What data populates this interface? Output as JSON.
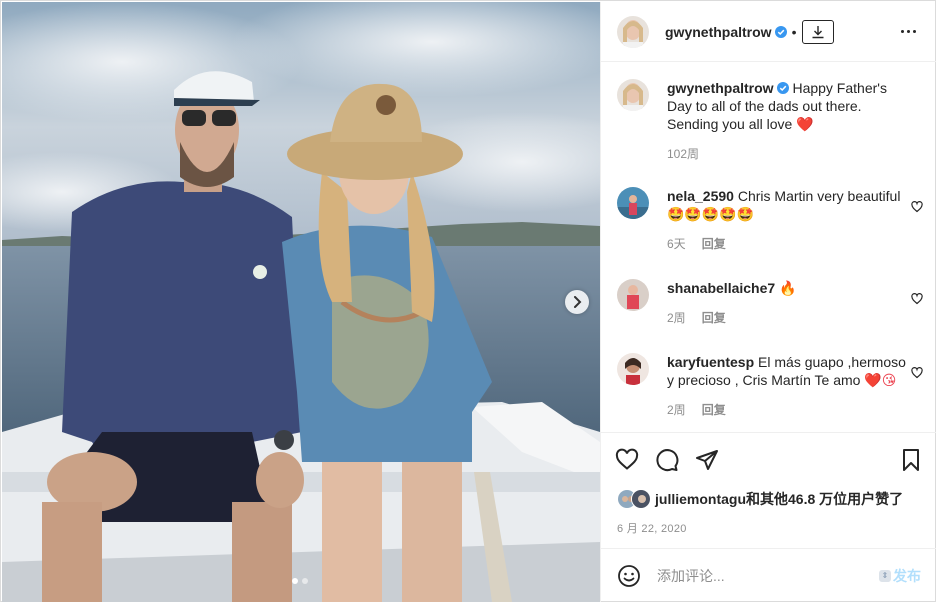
{
  "post": {
    "author": "gwynethpaltrow",
    "download_icon": "download-icon",
    "more_icon": "more-dots-icon",
    "caption_author": "gwynethpaltrow",
    "caption_text": "Happy Father's Day to all of the dads out there. Sending you all love",
    "caption_emoji": "❤️",
    "caption_age": "102周",
    "carousel": {
      "total_slides": 2,
      "current_slide": 1
    }
  },
  "comments": [
    {
      "user": "nela_2590",
      "text": "Chris Martin very beautiful",
      "emoji": "🤩🤩🤩🤩🤩",
      "age": "6天",
      "reply": "回复"
    },
    {
      "user": "shanabellaiche7",
      "text": "",
      "emoji": "🔥",
      "age": "2周",
      "reply": "回复"
    },
    {
      "user": "karyfuentesp",
      "text": "El más guapo ,hermoso y precioso , Cris Martín Te amo",
      "emoji": "❤️😘",
      "age": "2周",
      "reply": "回复"
    }
  ],
  "likes": {
    "text": "julliemontagu和其他46.8 万位用户赞了"
  },
  "date": "6 月 22, 2020",
  "add_comment": {
    "placeholder": "添加评论...",
    "post_label": "发布"
  },
  "colors": {
    "accent": "#0095f6",
    "post_disabled": "#b2dffc",
    "like_red": "#ed4956",
    "text": "#262626",
    "muted": "#8e8e8e"
  }
}
